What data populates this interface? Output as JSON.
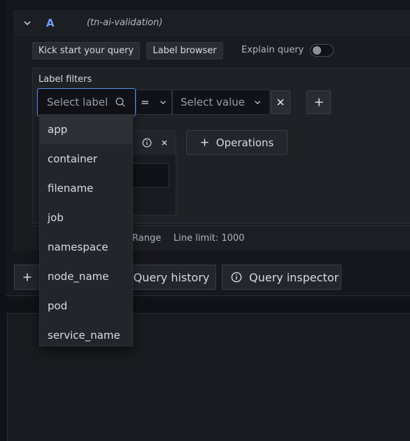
{
  "query_row": {
    "letter": "A",
    "datasource": "(tn-ai-validation)",
    "collapse_icon": "chevron-down-icon"
  },
  "toolbar": {
    "kick_start": "Kick start your query",
    "label_browser": "Label browser",
    "explain_query": "Explain query",
    "explain_toggle_on": false
  },
  "label_filters": {
    "title": "Label filters",
    "label_placeholder": "Select label",
    "operator": "=",
    "value_placeholder": "Select value"
  },
  "operations_button": "Operations",
  "options": {
    "range_fragment": "Range",
    "line_limit": "Line limit: 1000"
  },
  "actions": {
    "query_history": "Query history",
    "query_inspector": "Query inspector"
  },
  "label_dropdown": {
    "items": [
      "app",
      "container",
      "filename",
      "job",
      "namespace",
      "node_name",
      "pod",
      "service_name"
    ],
    "active_index": 0
  },
  "colors": {
    "accent": "#6e9fff",
    "background": "#111217",
    "panel": "#181b1f",
    "menu": "#22252b"
  }
}
